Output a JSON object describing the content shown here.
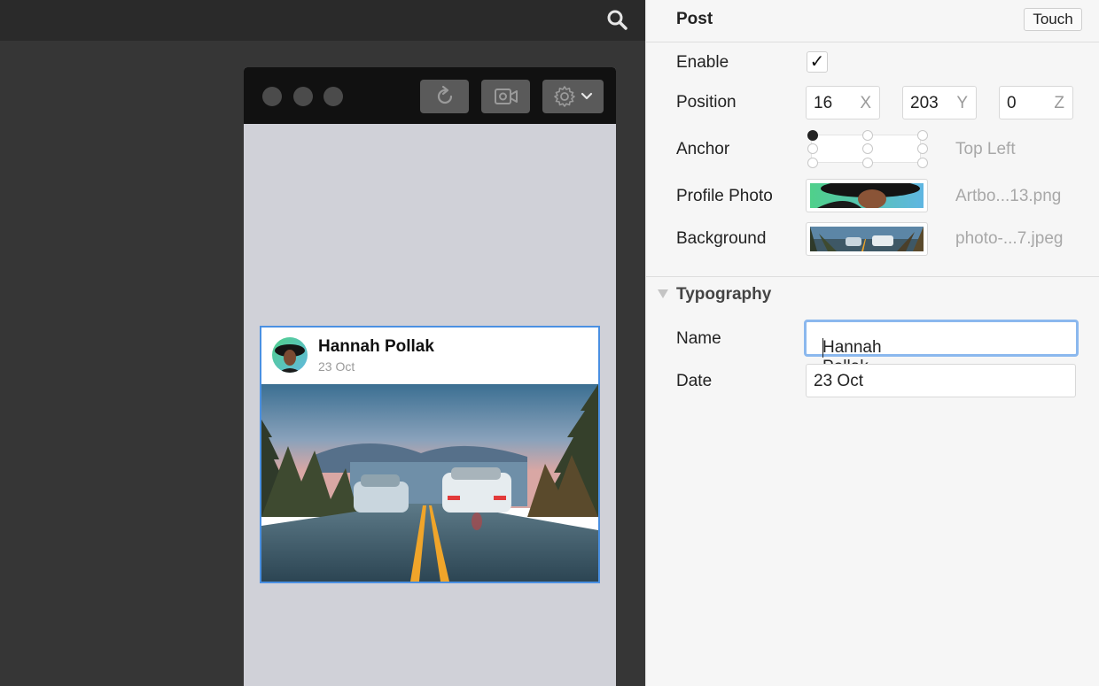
{
  "icons": {
    "search": "search-icon",
    "refresh": "refresh-icon",
    "video": "video-camera-icon",
    "settings": "gear-icon",
    "chevron": "chevron-down-icon",
    "disclosure": "disclosure-triangle-icon",
    "checkmark": "checkmark-icon"
  },
  "colors": {
    "accent": "#4a90e2",
    "focus_ring": "#8bb8ee",
    "device_bg": "#d0d1d8"
  },
  "post": {
    "name": "Hannah Pollak",
    "date": "23 Oct"
  },
  "inspector": {
    "title": "Post",
    "touch_label": "Touch",
    "enable": {
      "label": "Enable",
      "checked": true,
      "mark": "✓"
    },
    "position": {
      "label": "Position",
      "x": {
        "value": "16",
        "axis": "X"
      },
      "y": {
        "value": "203",
        "axis": "Y"
      },
      "z": {
        "value": "0",
        "axis": "Z"
      }
    },
    "anchor": {
      "label": "Anchor",
      "value": "Top Left"
    },
    "profile_photo": {
      "label": "Profile Photo",
      "file": "Artbo...13.png"
    },
    "background": {
      "label": "Background",
      "file": "photo-...7.jpeg"
    },
    "typography": {
      "section_label": "Typography",
      "name_label": "Name",
      "name_value": "Hannah Pollak",
      "date_label": "Date",
      "date_value": "23 Oct"
    }
  }
}
